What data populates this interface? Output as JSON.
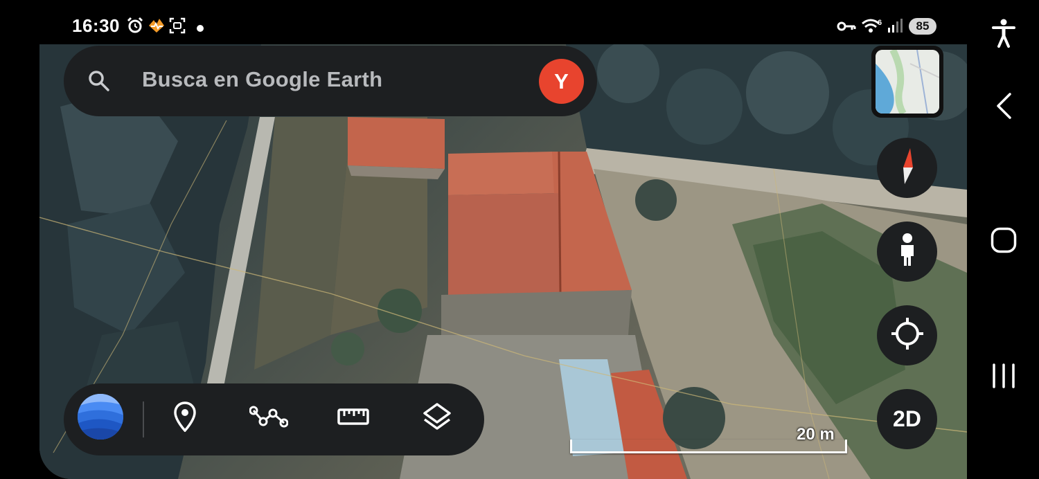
{
  "status_bar": {
    "time": "16:30",
    "left_icons": [
      "alarm-icon",
      "activity-icon",
      "screenshot-icon",
      "notification-dot-icon"
    ],
    "right_icons": [
      "vpn-key-icon",
      "wifi-icon",
      "signal-icon"
    ],
    "battery": "85"
  },
  "search": {
    "placeholder": "Busca en Google Earth",
    "avatar_letter": "Y"
  },
  "map_controls": {
    "minimap": "minimap-icon",
    "compass": "compass-icon",
    "street_view": "pegman-icon",
    "my_location": "location-target-icon",
    "view_mode": "2D"
  },
  "toolbar": {
    "items": [
      "earth-logo-icon",
      "place-pin-icon",
      "path-icon",
      "ruler-icon",
      "layers-icon"
    ]
  },
  "scale": {
    "label": "20 m"
  },
  "nav_bar": {
    "items": [
      "accessibility-icon",
      "back-icon",
      "home-icon",
      "recents-icon"
    ]
  },
  "colors": {
    "panel": "#1d1f21",
    "avatar": "#e8442e",
    "placeholder_text": "#b8babd",
    "compass_north": "#e8442e"
  }
}
